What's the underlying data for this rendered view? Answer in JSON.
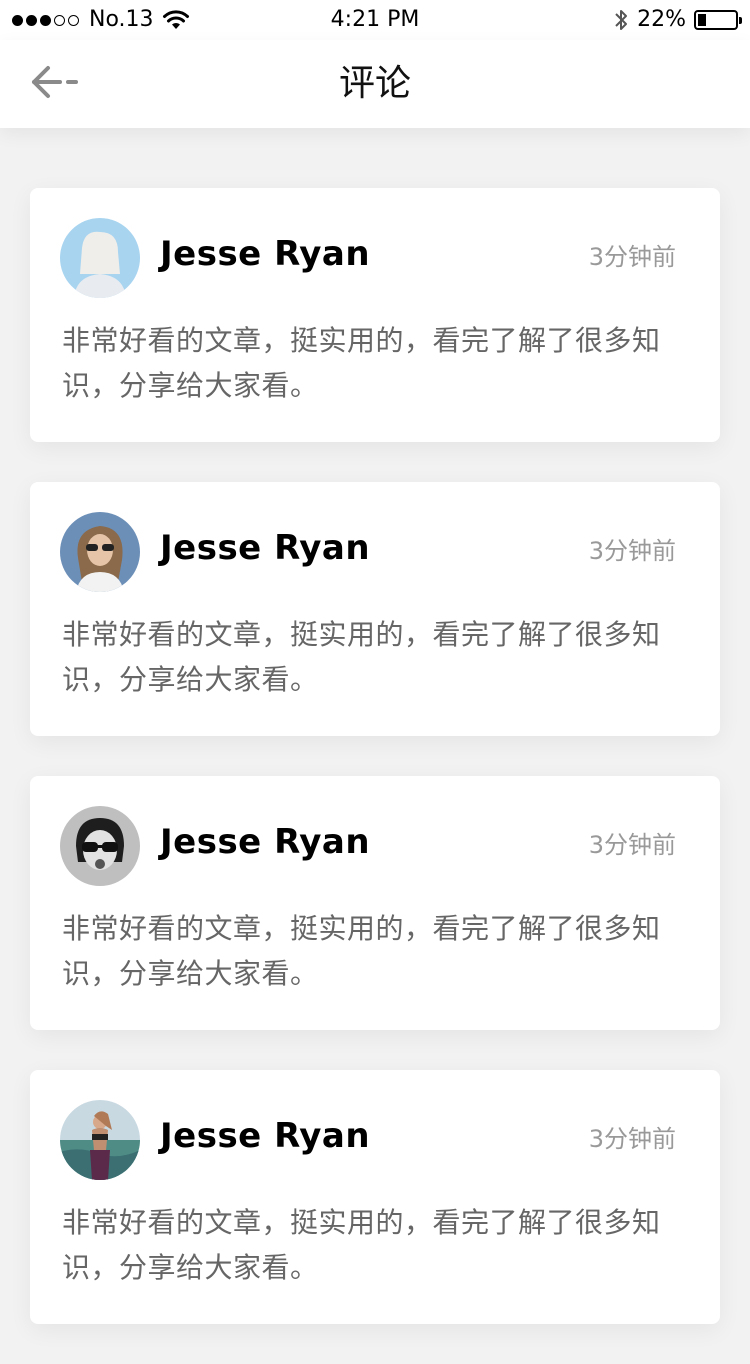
{
  "status_bar": {
    "carrier": "No.13",
    "time": "4:21 PM",
    "battery_percent": "22%",
    "battery_level": 0.22,
    "signal_strength": 3,
    "signal_max": 5,
    "icons": [
      "wifi-icon",
      "bluetooth-icon",
      "battery-icon"
    ]
  },
  "nav": {
    "title": "评论",
    "back_icon": "back-arrow-icon"
  },
  "comments": [
    {
      "username": "Jesse Ryan",
      "time": "3分钟前",
      "text": "非常好看的文章，挺实用的，看完了解了很多知识，分享给大家看。",
      "avatar": "avatar-icon"
    },
    {
      "username": "Jesse Ryan",
      "time": "3分钟前",
      "text": "非常好看的文章，挺实用的，看完了解了很多知识，分享给大家看。",
      "avatar": "avatar-icon"
    },
    {
      "username": "Jesse Ryan",
      "time": "3分钟前",
      "text": "非常好看的文章，挺实用的，看完了解了很多知识，分享给大家看。",
      "avatar": "avatar-icon"
    },
    {
      "username": "Jesse Ryan",
      "time": "3分钟前",
      "text": "非常好看的文章，挺实用的，看完了解了很多知识，分享给大家看。",
      "avatar": "avatar-icon"
    }
  ],
  "colors": {
    "background": "#f2f2f2",
    "card": "#ffffff",
    "username": "#000000",
    "comment_text": "#666666",
    "timestamp": "#999999"
  }
}
